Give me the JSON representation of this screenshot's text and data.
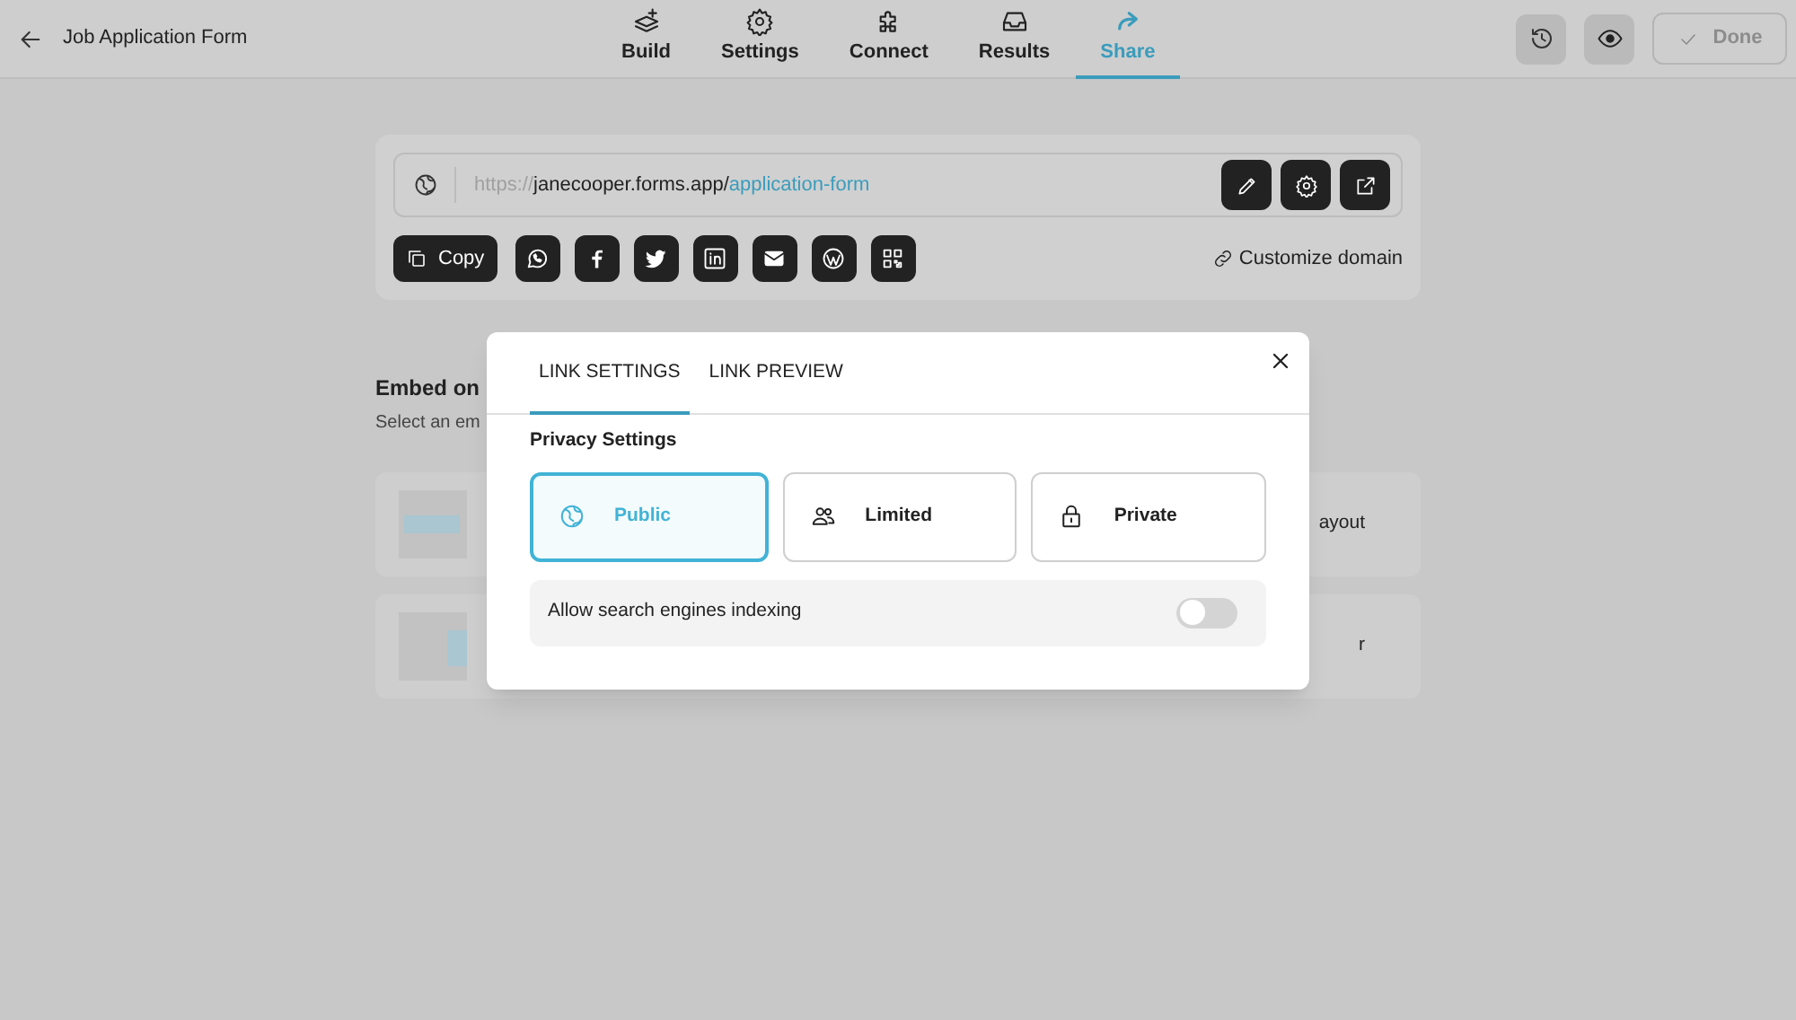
{
  "header": {
    "title": "Job Application Form",
    "nav": [
      {
        "label": "Build",
        "kind": "build",
        "selected": false
      },
      {
        "label": "Settings",
        "kind": "settings",
        "selected": false
      },
      {
        "label": "Connect",
        "kind": "connect",
        "selected": false
      },
      {
        "label": "Results",
        "kind": "results",
        "selected": false
      },
      {
        "label": "Share",
        "kind": "share",
        "selected": true
      }
    ],
    "done": {
      "label": "Done",
      "disabled": true
    }
  },
  "link": {
    "scheme": "https://",
    "domain": "janecooper.forms.app/",
    "path": "application-form"
  },
  "share_buttons": [
    {
      "kind": "copy",
      "label": "Copy"
    },
    {
      "kind": "whatsapp"
    },
    {
      "kind": "facebook"
    },
    {
      "kind": "twitter"
    },
    {
      "kind": "linkedin"
    },
    {
      "kind": "email"
    },
    {
      "kind": "wordpress"
    },
    {
      "kind": "qr"
    }
  ],
  "customize_domain": "Customize domain",
  "embed": {
    "title": "Embed on",
    "subtitle": "Select an em",
    "options": [
      {
        "kind": "banner",
        "label": "ayout"
      },
      {
        "kind": "side",
        "label": "r"
      }
    ]
  },
  "modal": {
    "tabs": [
      {
        "label": "LINK SETTINGS",
        "selected": true
      },
      {
        "label": "LINK PREVIEW",
        "selected": false
      }
    ],
    "section": "Privacy Settings",
    "privacy": [
      {
        "label": "Public",
        "kind": "globe",
        "selected": true
      },
      {
        "label": "Limited",
        "kind": "people",
        "selected": false
      },
      {
        "label": "Private",
        "kind": "lock",
        "selected": false
      }
    ],
    "indexing": {
      "label": "Allow search engines indexing",
      "on": false
    }
  }
}
